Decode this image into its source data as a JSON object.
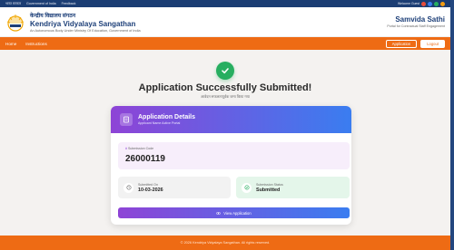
{
  "topbar": {
    "links": [
      "भारत सरकार",
      "Government of India",
      "Feedback"
    ],
    "right_text": "Welcome Guest",
    "dot_colors": [
      "#e74c3c",
      "#3a7df0",
      "#27ae60",
      "#f39c12"
    ]
  },
  "header": {
    "title_hindi": "केन्द्रीय विद्यालय संगठन",
    "title": "Kendriya Vidyalaya Sangathan",
    "subtitle": "An Autonomous Body Under Ministry Of Education, Government of India",
    "right_title": "Samvida Sathi",
    "right_subtitle": "Portal for Contractual Staff Engagement"
  },
  "nav": {
    "links": [
      "Home",
      "Instructions"
    ],
    "application_label": "Application",
    "logout_label": "Logout"
  },
  "success": {
    "title": "Application Successfully Submitted!",
    "subtitle": "आवेदन सफलतापूर्वक जमा किया गया"
  },
  "card": {
    "title": "Application Details",
    "subtitle": "Applicant Name Active Portal",
    "code_label": "Submission Code",
    "code_value": "26000119",
    "date_label": "Submitted On",
    "date_value": "10-03-2026",
    "status_label": "Submission Status",
    "status_value": "Submitted",
    "view_button": "View Application"
  },
  "footer": {
    "text": "© 2026 Kendriya Vidyalaya Sangathan. All rights reserved."
  },
  "colors": {
    "navy": "#1d3f78",
    "orange": "#ee6b14",
    "success": "#27ae60",
    "purple": "#8e44d6",
    "blue": "#3a7df0"
  }
}
